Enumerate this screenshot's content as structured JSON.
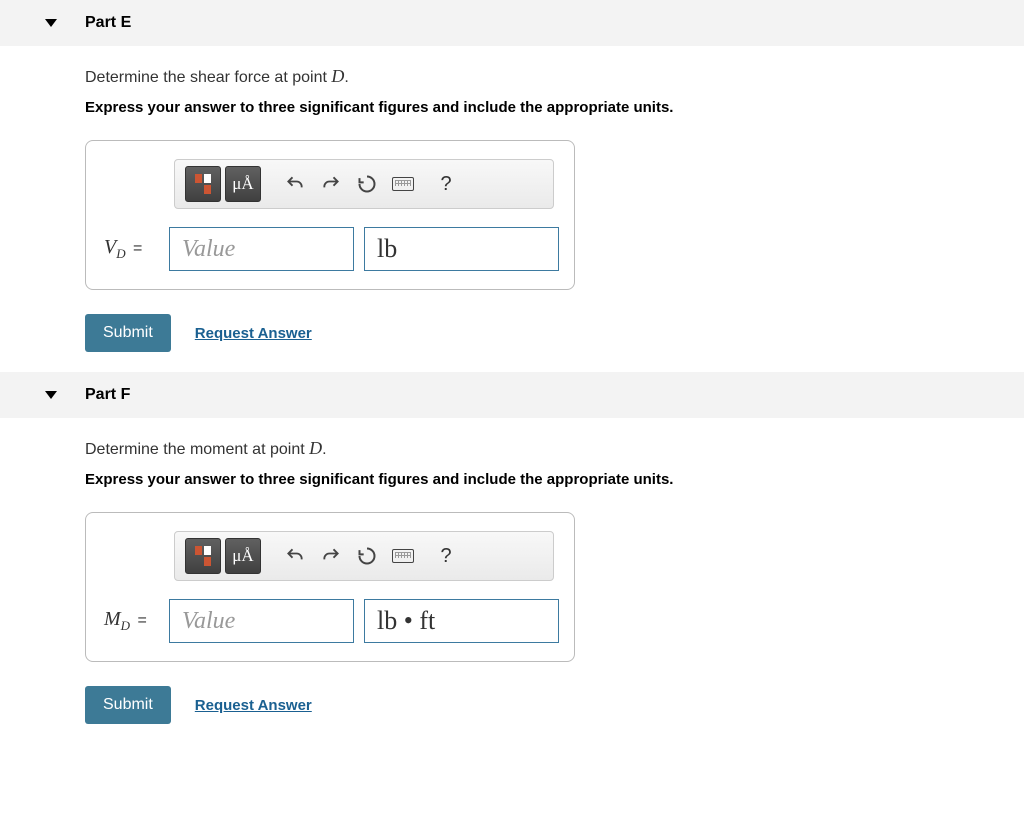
{
  "parts": {
    "E": {
      "title": "Part E",
      "question_prefix": "Determine the shear force at point ",
      "question_var": "D",
      "question_suffix": ".",
      "instruction": "Express your answer to three significant figures and include the appropriate units.",
      "var_symbol": "V",
      "var_subscript": "D",
      "value_placeholder": "Value",
      "units_value": "lb",
      "mu_a_label": "μÅ",
      "submit_label": "Submit",
      "request_label": "Request Answer",
      "help_label": "?"
    },
    "F": {
      "title": "Part F",
      "question_prefix": "Determine the moment at point ",
      "question_var": "D",
      "question_suffix": ".",
      "instruction": "Express your answer to three significant figures and include the appropriate units.",
      "var_symbol": "M",
      "var_subscript": "D",
      "value_placeholder": "Value",
      "units_value": "lb • ft",
      "mu_a_label": "μÅ",
      "submit_label": "Submit",
      "request_label": "Request Answer",
      "help_label": "?"
    }
  }
}
